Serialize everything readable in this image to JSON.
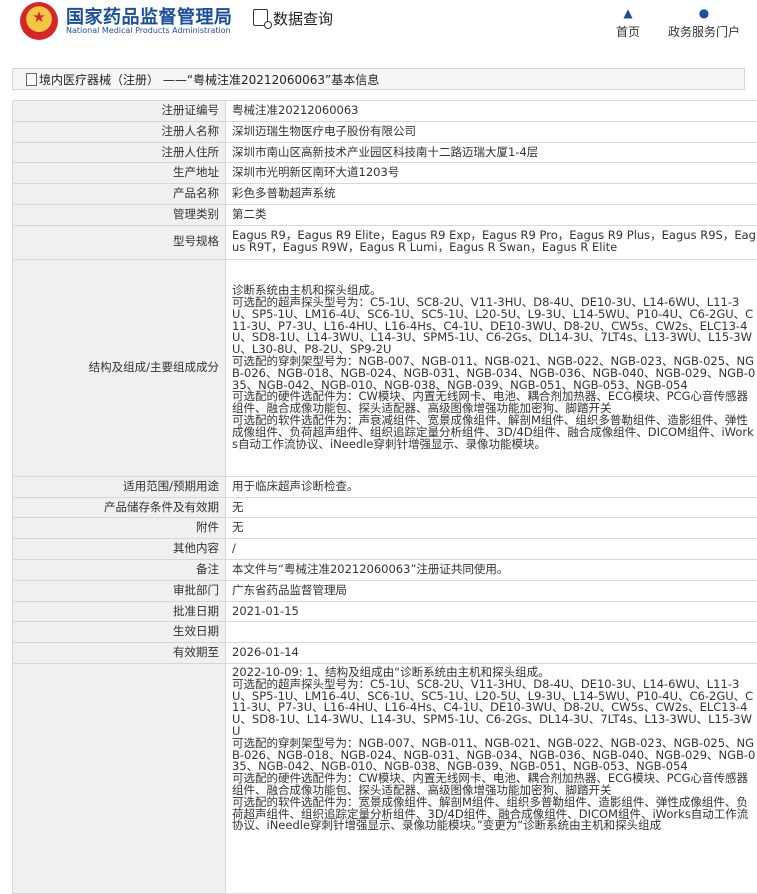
{
  "header": {
    "logo_cn": "国家药品监督管理局",
    "logo_en": "National Medical Products Administration",
    "query_label": "数据查询",
    "nav": [
      {
        "label": "首页",
        "icon": "home-icon"
      },
      {
        "label": "政务服务门户",
        "icon": "user-icon"
      }
    ]
  },
  "breadcrumb": "境内医疗器械（注册） ——“粤械注准20212060063”基本信息",
  "fields": [
    {
      "label": "注册证编号",
      "value": "粤械注准20212060063"
    },
    {
      "label": "注册人名称",
      "value": "深圳迈瑞生物医疗电子股份有限公司"
    },
    {
      "label": "注册人住所",
      "value": "深圳市南山区高新技术产业园区科技南十二路迈瑞大厦1-4层"
    },
    {
      "label": "生产地址",
      "value": "深圳市光明新区南环大道1203号"
    },
    {
      "label": "产品名称",
      "value": "彩色多普勒超声系统"
    },
    {
      "label": "管理类别",
      "value": "第二类"
    },
    {
      "label": "型号规格",
      "value": "Eagus R9，Eagus R9 Elite，Eagus R9 Exp，Eagus R9 Pro，Eagus R9 Plus，Eagus R9S，Eagus R9T，Eagus R9W，Eagus R Lumi，Eagus R Swan，Eagus R Elite"
    },
    {
      "label": "结构及组成/主要组成成分",
      "value": "诊断系统由主机和探头组成。\n可选配的超声探头型号为：C5-1U、SC8-2U、V11-3HU、D8-4U、DE10-3U、L14-6WU、L11-3U、SP5-1U、LM16-4U、SC6-1U、SC5-1U、L20-5U、L9-3U、L14-5WU、P10-4U、C6-2GU、C11-3U、P7-3U、L16-4HU、L16-4Hs、C4-1U、DE10-3WU、D8-2U、CW5s、CW2s、ELC13-4U、SD8-1U、L14-3WU、L14-3U、SPM5-1U、C6-2Gs、DL14-3U、7LT4s、L13-3WU、L15-3WU、L30-8U、P8-2U、SP9-2U\n可选配的穿刺架型号为：NGB-007、NGB-011、NGB-021、NGB-022、NGB-023、NGB-025、NGB-026、NGB-018、NGB-024、NGB-031、NGB-034、NGB-036、NGB-040、NGB-029、NGB-035、NGB-042、NGB-010、NGB-038、NGB-039、NGB-051、NGB-053、NGB-054\n可选配的硬件选配件为：CW模块、内置无线网卡、电池、耦合剂加热器、ECG模块、PCG心音传感器组件、融合成像功能包、探头适配器、高级图像增强功能加密狗、脚踏开关\n可选配的软件选配件为：声衰减组件、宽景成像组件、解剖M组件、组织多普勒组件、造影组件、弹性成像组件、负荷超声组件、组织追踪定量分析组件、3D/4D组件、融合成像组件、DICOM组件、iWorks自动工作流协议、iNeedle穿刺针增强显示、录像功能模块。"
    },
    {
      "label": "适用范围/预期用途",
      "value": "用于临床超声诊断检查。"
    },
    {
      "label": "产品储存条件及有效期",
      "value": "无"
    },
    {
      "label": "附件",
      "value": "无"
    },
    {
      "label": "其他内容",
      "value": "/"
    },
    {
      "label": "备注",
      "value": "本文件与“粤械注准20212060063”注册证共同使用。"
    },
    {
      "label": "审批部门",
      "value": "广东省药品监督管理局"
    },
    {
      "label": "批准日期",
      "value": "2021-01-15"
    },
    {
      "label": "生效日期",
      "value": ""
    },
    {
      "label": "有效期至",
      "value": "2026-01-14"
    },
    {
      "label": "",
      "value": "2022-10-09: 1、结构及组成由“诊断系统由主机和探头组成。\n可选配的超声探头型号为：C5-1U、SC8-2U、V11-3HU、D8-4U、DE10-3U、L14-6WU、L11-3U、SP5-1U、LM16-4U、SC6-1U、SC5-1U、L20-5U、L9-3U、L14-5WU、P10-4U、C6-2GU、C11-3U、P7-3U、L16-4HU、L16-4Hs、C4-1U、DE10-3WU、D8-2U、CW5s、CW2s、ELC13-4U、SD8-1U、L14-3WU、L14-3U、SPM5-1U、C6-2Gs、DL14-3U、7LT4s、L13-3WU、L15-3WU\n可选配的穿刺架型号为：NGB-007、NGB-011、NGB-021、NGB-022、NGB-023、NGB-025、NGB-026、NGB-018、NGB-024、NGB-031、NGB-034、NGB-036、NGB-040、NGB-029、NGB-035、NGB-042、NGB-010、NGB-038、NGB-039、NGB-051、NGB-053、NGB-054\n可选配的硬件选配件为：CW模块、内置无线网卡、电池、耦合剂加热器、ECG模块、PCG心音传感器组件、融合成像功能包、探头适配器、高级图像增强功能加密狗、脚踏开关\n可选配的软件选配件为：宽景成像组件、解剖M组件、组织多普勒组件、造影组件、弹性成像组件、负荷超声组件、组织追踪定量分析组件、3D/4D组件、融合成像组件、DICOM组件、iWorks自动工作流协议、iNeedle穿刺针增强显示、录像功能模块。”变更为“诊断系统由主机和探头组成"
    }
  ]
}
